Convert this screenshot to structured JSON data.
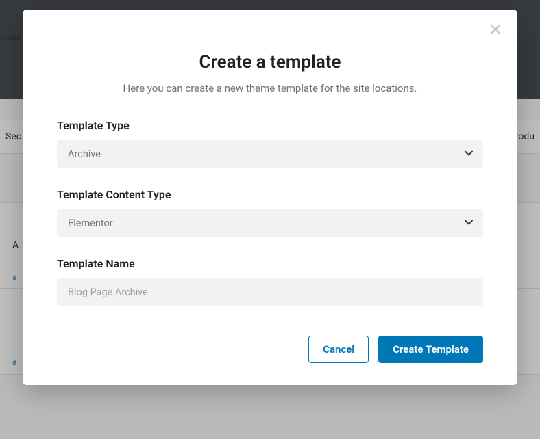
{
  "background": {
    "hint_left": "e bac",
    "tab_left": "Sec",
    "tab_right": "rodu",
    "row_a": "A",
    "row_b": "a",
    "row_c": "a"
  },
  "modal": {
    "title": "Create a template",
    "subtitle": "Here you can create a new theme template for the site locations.",
    "close_label": "Close"
  },
  "form": {
    "template_type": {
      "label": "Template Type",
      "value": "Archive"
    },
    "content_type": {
      "label": "Template Content Type",
      "value": "Elementor"
    },
    "template_name": {
      "label": "Template Name",
      "placeholder": "Blog Page Archive",
      "value": ""
    }
  },
  "buttons": {
    "cancel": "Cancel",
    "create": "Create Template"
  }
}
